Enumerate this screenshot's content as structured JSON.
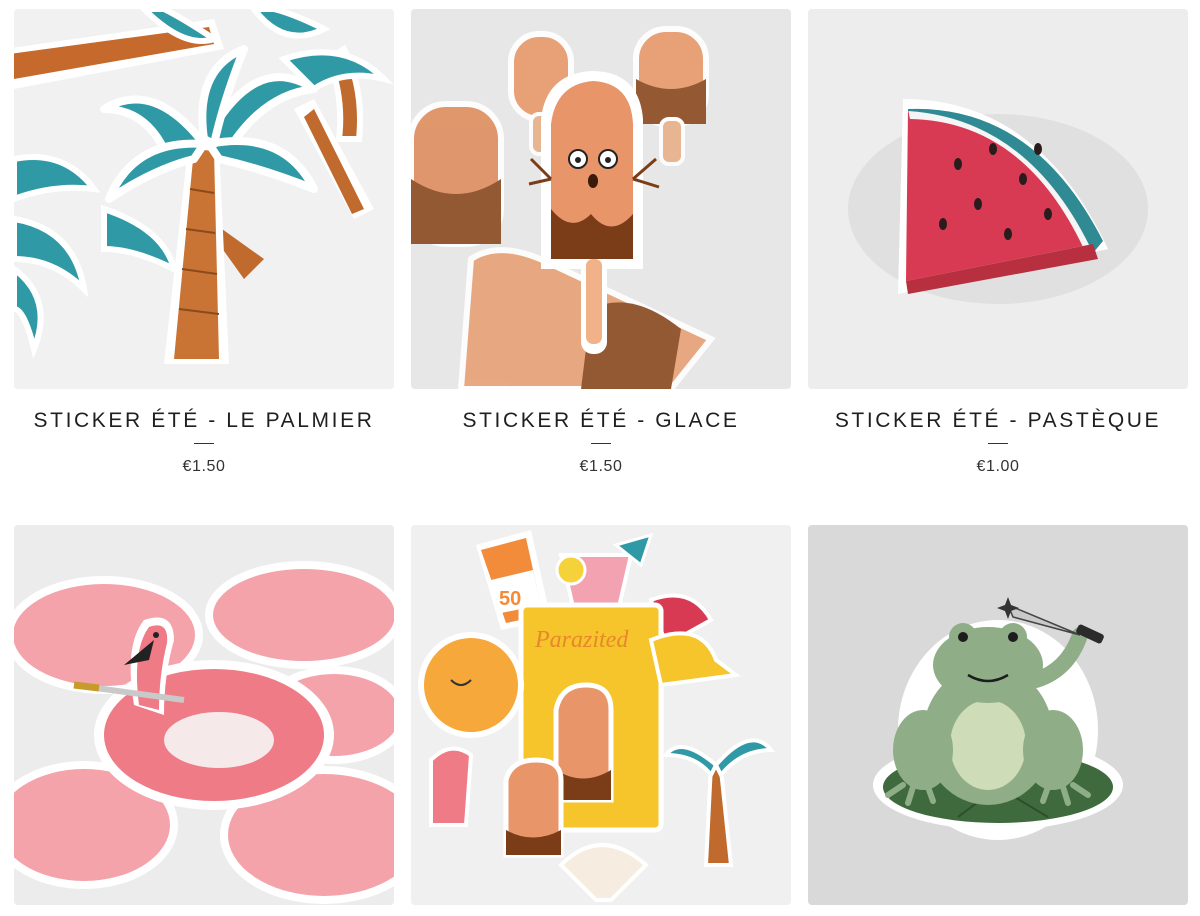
{
  "products": [
    {
      "title": "STICKER ÉTÉ - LE PALMIER",
      "price": "€1.50",
      "image": "palm-tree-stickers"
    },
    {
      "title": "STICKER ÉTÉ - GLACE",
      "price": "€1.50",
      "image": "ice-cream-stickers"
    },
    {
      "title": "STICKER ÉTÉ - PASTÈQUE",
      "price": "€1.00",
      "image": "watermelon-sticker"
    },
    {
      "title": "",
      "price": "",
      "image": "flamingo-float-stickers"
    },
    {
      "title": "",
      "price": "",
      "image": "summer-sticker-pack"
    },
    {
      "title": "",
      "price": "",
      "image": "frog-knife-sticker"
    }
  ],
  "pack_artwork": {
    "sunscreen_number": "50",
    "logo_text": "Parazited"
  },
  "colors": {
    "accent_teal": "#2f9aa6",
    "flamingo_pink": "#ef7b86",
    "watermelon_red": "#d73a52",
    "frog_green": "#8fae88"
  }
}
